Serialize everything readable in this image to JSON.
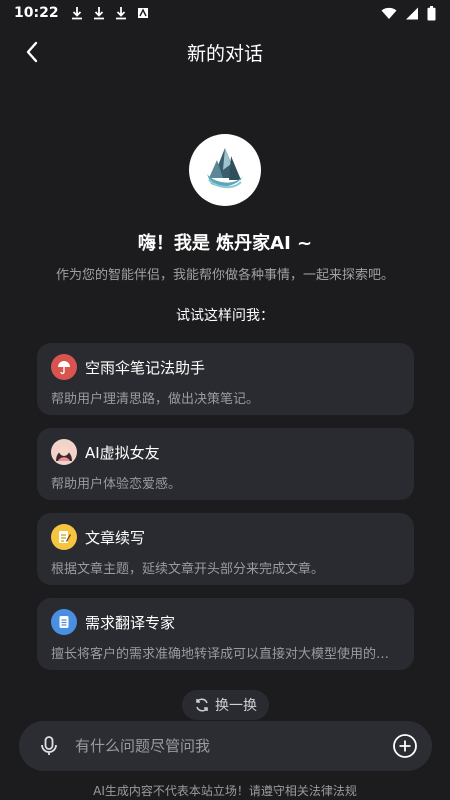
{
  "status_bar": {
    "time": "10:22",
    "icons": [
      "download-icon",
      "download-icon",
      "download-icon",
      "app-icon",
      "wifi-icon",
      "signal-icon",
      "battery-icon"
    ]
  },
  "header": {
    "title": "新的对话"
  },
  "intro": {
    "greeting": "嗨！我是 炼丹家AI ~",
    "subtitle": "作为您的智能伴侣，我能帮你做各种事情，一起来探索吧。",
    "try_label": "试试这样问我："
  },
  "cards": [
    {
      "icon": "umbrella-icon",
      "title": "空雨伞笔记法助手",
      "desc": "帮助用户理清思路，做出决策笔记。"
    },
    {
      "icon": "avatar-girl-icon",
      "title": "AI虚拟女友",
      "desc": "帮助用户体验恋爱感。"
    },
    {
      "icon": "notepad-icon",
      "title": "文章续写",
      "desc": "根据文章主题，延续文章开头部分来完成文章。"
    },
    {
      "icon": "document-icon",
      "title": "需求翻译专家",
      "desc": "擅长将客户的需求准确地转译成可以直接对大模型使用的提示词。"
    }
  ],
  "refresh": {
    "label": "换一换"
  },
  "input": {
    "placeholder": "有什么问题尽管问我",
    "value": ""
  },
  "disclaimer": "AI生成内容不代表本站立场！请遵守相关法律法规",
  "colors": {
    "background": "#1c1c1e",
    "card": "#2a2b30",
    "umbrella_accent": "#d9534f",
    "document_accent": "#4a90e2",
    "notepad_accent": "#f5c542"
  }
}
